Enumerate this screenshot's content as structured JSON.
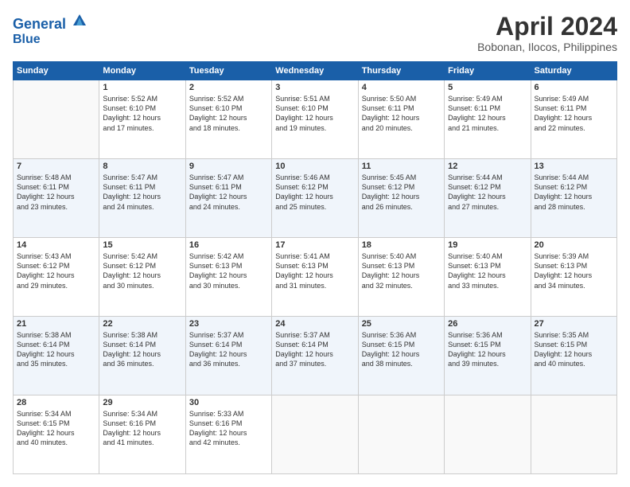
{
  "header": {
    "logo_line1": "General",
    "logo_line2": "Blue",
    "month": "April 2024",
    "location": "Bobonan, Ilocos, Philippines"
  },
  "weekdays": [
    "Sunday",
    "Monday",
    "Tuesday",
    "Wednesday",
    "Thursday",
    "Friday",
    "Saturday"
  ],
  "weeks": [
    [
      {
        "day": "",
        "info": ""
      },
      {
        "day": "1",
        "info": "Sunrise: 5:52 AM\nSunset: 6:10 PM\nDaylight: 12 hours\nand 17 minutes."
      },
      {
        "day": "2",
        "info": "Sunrise: 5:52 AM\nSunset: 6:10 PM\nDaylight: 12 hours\nand 18 minutes."
      },
      {
        "day": "3",
        "info": "Sunrise: 5:51 AM\nSunset: 6:10 PM\nDaylight: 12 hours\nand 19 minutes."
      },
      {
        "day": "4",
        "info": "Sunrise: 5:50 AM\nSunset: 6:11 PM\nDaylight: 12 hours\nand 20 minutes."
      },
      {
        "day": "5",
        "info": "Sunrise: 5:49 AM\nSunset: 6:11 PM\nDaylight: 12 hours\nand 21 minutes."
      },
      {
        "day": "6",
        "info": "Sunrise: 5:49 AM\nSunset: 6:11 PM\nDaylight: 12 hours\nand 22 minutes."
      }
    ],
    [
      {
        "day": "7",
        "info": "Sunrise: 5:48 AM\nSunset: 6:11 PM\nDaylight: 12 hours\nand 23 minutes."
      },
      {
        "day": "8",
        "info": "Sunrise: 5:47 AM\nSunset: 6:11 PM\nDaylight: 12 hours\nand 24 minutes."
      },
      {
        "day": "9",
        "info": "Sunrise: 5:47 AM\nSunset: 6:11 PM\nDaylight: 12 hours\nand 24 minutes."
      },
      {
        "day": "10",
        "info": "Sunrise: 5:46 AM\nSunset: 6:12 PM\nDaylight: 12 hours\nand 25 minutes."
      },
      {
        "day": "11",
        "info": "Sunrise: 5:45 AM\nSunset: 6:12 PM\nDaylight: 12 hours\nand 26 minutes."
      },
      {
        "day": "12",
        "info": "Sunrise: 5:44 AM\nSunset: 6:12 PM\nDaylight: 12 hours\nand 27 minutes."
      },
      {
        "day": "13",
        "info": "Sunrise: 5:44 AM\nSunset: 6:12 PM\nDaylight: 12 hours\nand 28 minutes."
      }
    ],
    [
      {
        "day": "14",
        "info": "Sunrise: 5:43 AM\nSunset: 6:12 PM\nDaylight: 12 hours\nand 29 minutes."
      },
      {
        "day": "15",
        "info": "Sunrise: 5:42 AM\nSunset: 6:12 PM\nDaylight: 12 hours\nand 30 minutes."
      },
      {
        "day": "16",
        "info": "Sunrise: 5:42 AM\nSunset: 6:13 PM\nDaylight: 12 hours\nand 30 minutes."
      },
      {
        "day": "17",
        "info": "Sunrise: 5:41 AM\nSunset: 6:13 PM\nDaylight: 12 hours\nand 31 minutes."
      },
      {
        "day": "18",
        "info": "Sunrise: 5:40 AM\nSunset: 6:13 PM\nDaylight: 12 hours\nand 32 minutes."
      },
      {
        "day": "19",
        "info": "Sunrise: 5:40 AM\nSunset: 6:13 PM\nDaylight: 12 hours\nand 33 minutes."
      },
      {
        "day": "20",
        "info": "Sunrise: 5:39 AM\nSunset: 6:13 PM\nDaylight: 12 hours\nand 34 minutes."
      }
    ],
    [
      {
        "day": "21",
        "info": "Sunrise: 5:38 AM\nSunset: 6:14 PM\nDaylight: 12 hours\nand 35 minutes."
      },
      {
        "day": "22",
        "info": "Sunrise: 5:38 AM\nSunset: 6:14 PM\nDaylight: 12 hours\nand 36 minutes."
      },
      {
        "day": "23",
        "info": "Sunrise: 5:37 AM\nSunset: 6:14 PM\nDaylight: 12 hours\nand 36 minutes."
      },
      {
        "day": "24",
        "info": "Sunrise: 5:37 AM\nSunset: 6:14 PM\nDaylight: 12 hours\nand 37 minutes."
      },
      {
        "day": "25",
        "info": "Sunrise: 5:36 AM\nSunset: 6:15 PM\nDaylight: 12 hours\nand 38 minutes."
      },
      {
        "day": "26",
        "info": "Sunrise: 5:36 AM\nSunset: 6:15 PM\nDaylight: 12 hours\nand 39 minutes."
      },
      {
        "day": "27",
        "info": "Sunrise: 5:35 AM\nSunset: 6:15 PM\nDaylight: 12 hours\nand 40 minutes."
      }
    ],
    [
      {
        "day": "28",
        "info": "Sunrise: 5:34 AM\nSunset: 6:15 PM\nDaylight: 12 hours\nand 40 minutes."
      },
      {
        "day": "29",
        "info": "Sunrise: 5:34 AM\nSunset: 6:16 PM\nDaylight: 12 hours\nand 41 minutes."
      },
      {
        "day": "30",
        "info": "Sunrise: 5:33 AM\nSunset: 6:16 PM\nDaylight: 12 hours\nand 42 minutes."
      },
      {
        "day": "",
        "info": ""
      },
      {
        "day": "",
        "info": ""
      },
      {
        "day": "",
        "info": ""
      },
      {
        "day": "",
        "info": ""
      }
    ]
  ]
}
